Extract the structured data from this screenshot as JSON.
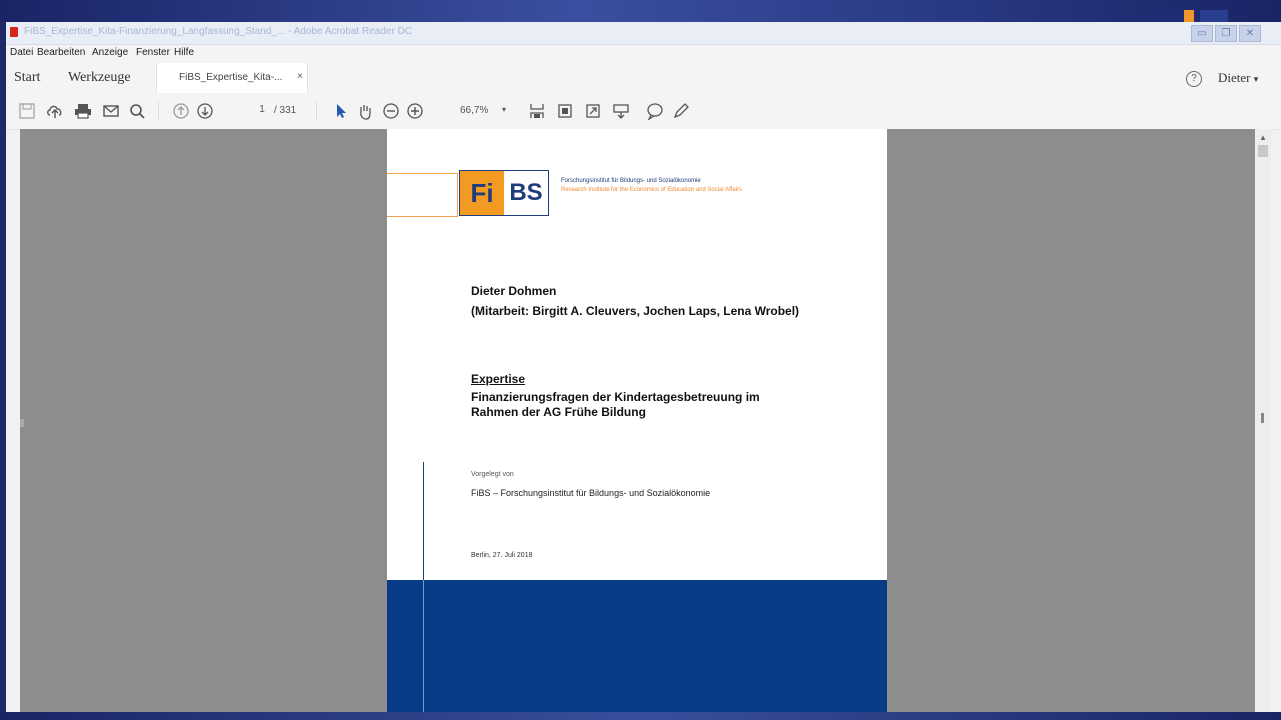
{
  "window": {
    "title": "FiBS_Expertise_Kita-Finanzierung_Langfassung_Stand_... - Adobe Acrobat Reader DC",
    "controls": {
      "minimize": "▭",
      "restore": "❐",
      "close": "✕"
    }
  },
  "menu": {
    "items": [
      "Datei",
      "Bearbeiten",
      "Anzeige",
      "Fenster",
      "Hilfe"
    ]
  },
  "tabs": {
    "start": "Start",
    "tools": "Werkzeuge",
    "document": "FiBS_Expertise_Kita-...",
    "close": "×"
  },
  "account": {
    "help": "?",
    "user": "Dieter",
    "arrow": "▾"
  },
  "toolbar": {
    "page_current": "1",
    "page_total": "/ 331",
    "zoom": "66,7%",
    "zoom_arrow": "▾"
  },
  "document": {
    "logo_left": "Fi",
    "logo_right": "BS",
    "institute_de": "Forschungsinstitut für Bildungs- und Sozialökonomie",
    "institute_en": "Research Institute for the Economics of Education and Social Affairs",
    "author": "Dieter Dohmen",
    "collaborators": "(Mitarbeit: Birgitt A. Cleuvers, Jochen Laps, Lena Wrobel)",
    "expertise": "Expertise",
    "subtitle": "Finanzierungsfragen der Kindertagesbetreuung im Rahmen der AG Frühe Bildung",
    "presented_by": "Vorgelegt von",
    "organization": "FiBS – Forschungsinstitut für Bildungs- und Sozialökonomie",
    "date": "Berlin, 27. Juli 2018"
  },
  "scrollbar": {
    "up": "▲"
  },
  "colors": {
    "brand_orange": "#f39a23",
    "brand_blue": "#1f3d7a",
    "footer_blue": "#073b86"
  }
}
